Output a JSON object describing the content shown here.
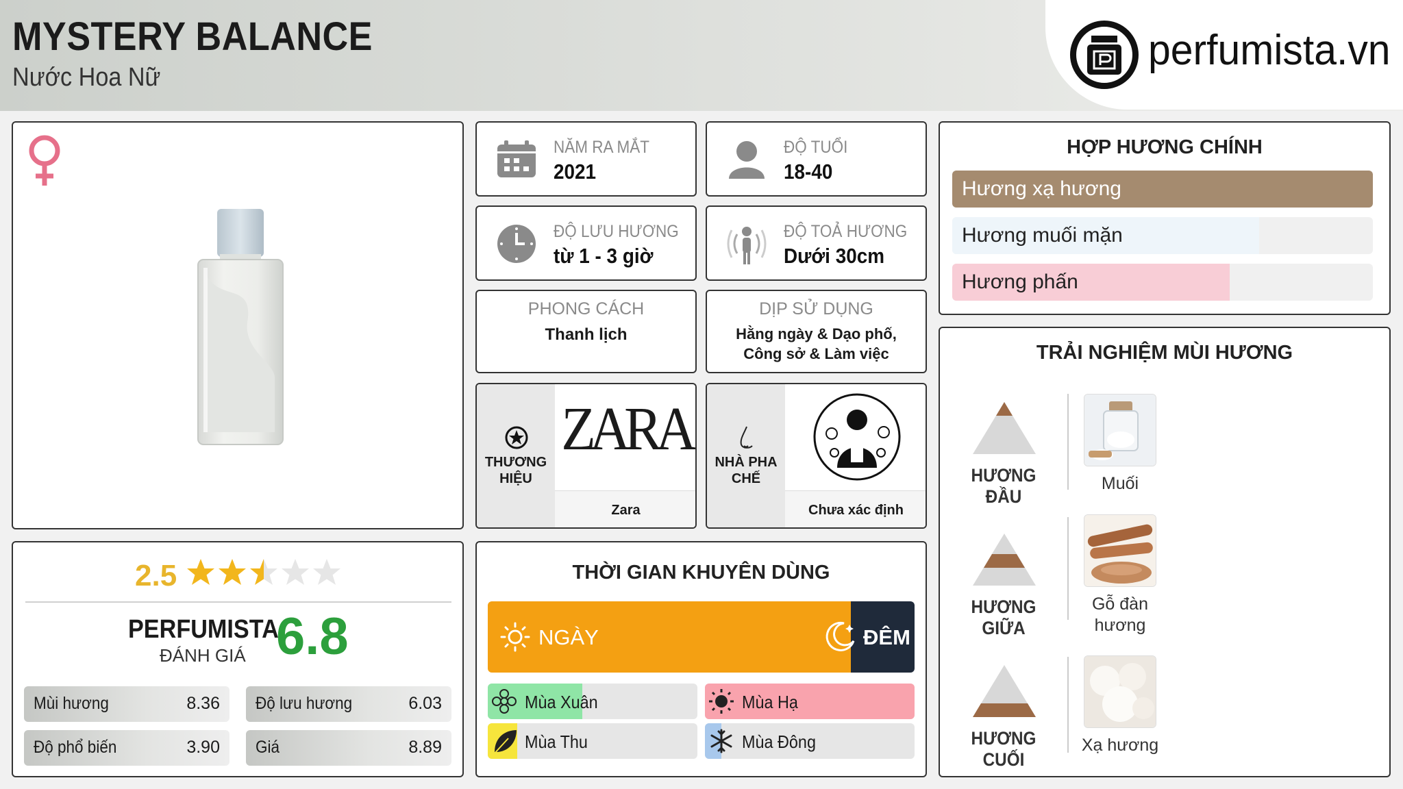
{
  "header": {
    "title": "MYSTERY BALANCE",
    "subtitle": "Nước Hoa Nữ",
    "logo_text": "perfumista.vn"
  },
  "product": {
    "gender_icon": "female-symbol-icon"
  },
  "info": {
    "launch": {
      "label": "NĂM RA MẮT",
      "value": "2021",
      "icon": "calendar-icon"
    },
    "age": {
      "label": "ĐỘ TUỔI",
      "value": "18-40",
      "icon": "person-icon"
    },
    "longevity": {
      "label": "ĐỘ LƯU HƯƠNG",
      "value": "từ 1 - 3 giờ",
      "icon": "clock-icon"
    },
    "sillage": {
      "label": "ĐỘ TOẢ HƯƠNG",
      "value": "Dưới 30cm",
      "icon": "radiate-person-icon"
    },
    "style": {
      "label": "PHONG CÁCH",
      "value": "Thanh lịch"
    },
    "occasion": {
      "label": "DỊP SỬ DỤNG",
      "value": "Hằng ngày & Dạo phố, Công sở & Làm việc"
    },
    "brand": {
      "label": "THƯƠNG HIỆU",
      "logo_text": "ZARA",
      "name": "Zara",
      "icon": "star-circle-icon"
    },
    "perfumer": {
      "label": "NHÀ PHA CHẾ",
      "name": "Chưa xác định",
      "icon": "nose-icon"
    }
  },
  "accords": {
    "title": "HỢP HƯƠNG CHÍNH",
    "items": [
      {
        "label": "Hương xạ hương",
        "level": 1.0,
        "color": "#a58b6f",
        "text_color": "#ffffff"
      },
      {
        "label": "Hương muối mặn",
        "level": 0.73,
        "color": "#eef5fa",
        "text_color": "#222222"
      },
      {
        "label": "Hương phấn",
        "level": 0.66,
        "color": "#f8cdd6",
        "text_color": "#222222"
      }
    ]
  },
  "rating": {
    "stars_value": "2.5",
    "stars_fraction": 0.5,
    "perfumista_label": "PERFUMISTA",
    "review_label": "ĐÁNH GIÁ",
    "score": "6.8",
    "scores": [
      {
        "label": "Mùi hương",
        "value": "8.36"
      },
      {
        "label": "Độ lưu hương",
        "value": "6.03"
      },
      {
        "label": "Độ phổ biến",
        "value": "3.90"
      },
      {
        "label": "Giá",
        "value": "8.89"
      }
    ]
  },
  "time": {
    "title": "THỜI GIAN KHUYÊN DÙNG",
    "day_label": "NGÀY",
    "night_label": "ĐÊM",
    "day_level": 0.85,
    "day_color": "#f4a012",
    "night_color": "#1f2a3a",
    "seasons": [
      {
        "label": "Mùa Xuân",
        "level": 0.45,
        "color": "#8fe5a6",
        "icon": "flower-icon"
      },
      {
        "label": "Mùa Hạ",
        "level": 1.0,
        "color": "#f9a3ad",
        "icon": "sun-icon"
      },
      {
        "label": "Mùa Thu",
        "level": 0.14,
        "color": "#f6e53c",
        "icon": "leaf-icon"
      },
      {
        "label": "Mùa Đông",
        "level": 0.08,
        "color": "#a8c8ec",
        "icon": "snowflake-icon"
      }
    ]
  },
  "experience": {
    "title": "TRẢI NGHIỆM MÙI HƯƠNG",
    "tiers": [
      {
        "label": "HƯƠNG ĐẦU",
        "notes": [
          "Muối"
        ]
      },
      {
        "label": "HƯƠNG GIỮA",
        "notes": [
          "Gỗ đàn hương"
        ]
      },
      {
        "label": "HƯƠNG CUỐI",
        "notes": [
          "Xạ hương"
        ]
      }
    ]
  }
}
